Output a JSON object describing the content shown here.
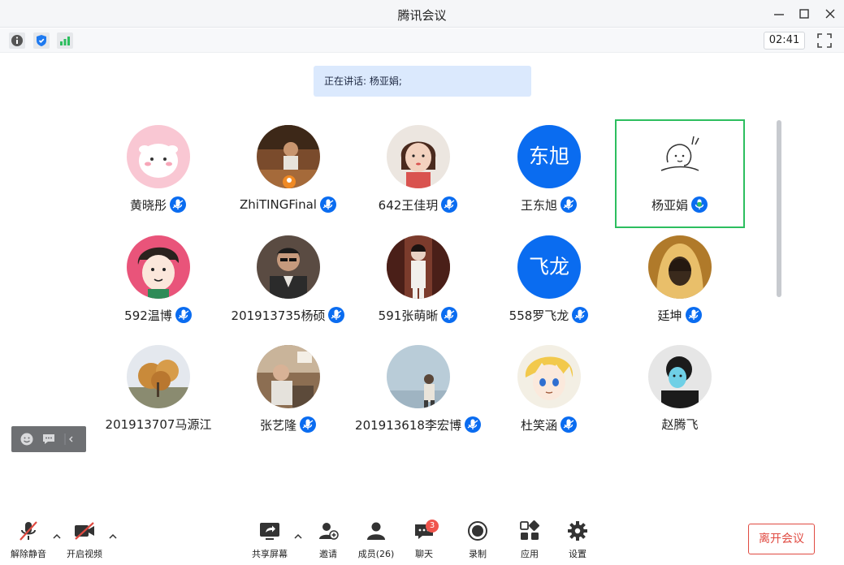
{
  "window": {
    "title": "腾讯会议"
  },
  "status": {
    "timer": "02:41"
  },
  "speaking": {
    "text": "正在讲话: 杨亚娟;"
  },
  "participants": [
    {
      "name": "黄晓彤",
      "avatar_kind": "cartoon-sheep",
      "mic": "on"
    },
    {
      "name": "ZhiTINGFinal",
      "avatar_kind": "photo-person",
      "mic": "on"
    },
    {
      "name": "642王佳玥",
      "avatar_kind": "cartoon-girl",
      "mic": "on"
    },
    {
      "name": "王东旭",
      "avatar_text": "东旭",
      "mic": "on"
    },
    {
      "name": "杨亚娟",
      "avatar_kind": "sketch-girl",
      "mic": "speaking"
    },
    {
      "name": "592温博",
      "avatar_kind": "cartoon-face",
      "mic": "on"
    },
    {
      "name": "201913735杨硕",
      "avatar_kind": "photo-man",
      "mic": "on"
    },
    {
      "name": "591张萌晰",
      "avatar_kind": "photo-woman",
      "mic": "on"
    },
    {
      "name": "558罗飞龙",
      "avatar_text": "飞龙",
      "mic": "on"
    },
    {
      "name": "廷坤",
      "avatar_kind": "photo-hood",
      "mic": "on"
    },
    {
      "name": "201913707马源江",
      "avatar_kind": "photo-tree",
      "mic": "none"
    },
    {
      "name": "张艺隆",
      "avatar_kind": "photo-room",
      "mic": "on"
    },
    {
      "name": "201913618李宏博",
      "avatar_kind": "photo-sky",
      "mic": "on"
    },
    {
      "name": "杜笑涵",
      "avatar_kind": "anime-boy",
      "mic": "on"
    },
    {
      "name": "赵腾飞",
      "avatar_kind": "photo-balloon",
      "mic": "none"
    }
  ],
  "toolbar": {
    "unmute": "解除静音",
    "start_video": "开启视频",
    "share_screen": "共享屏幕",
    "invite": "邀请",
    "members": "成员(26)",
    "chat": "聊天",
    "chat_badge": "3",
    "record": "录制",
    "apps": "应用",
    "settings": "设置",
    "leave": "离开会议"
  },
  "colors": {
    "accent": "#0a6cf0",
    "speaking_border": "#2dbe5f",
    "speaking_banner": "#dbe9fd",
    "leave": "#e04a41"
  }
}
